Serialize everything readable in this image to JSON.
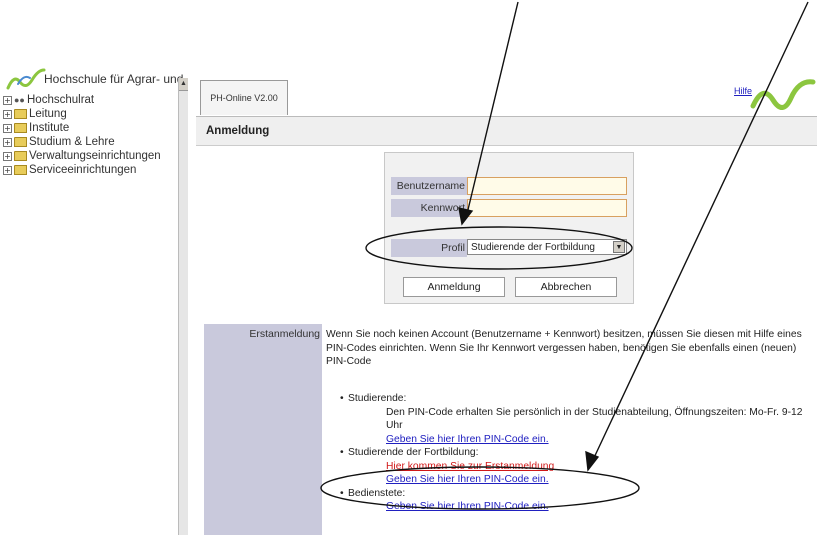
{
  "left_nav": {
    "university": "Hochschule für Agrar- und",
    "items": [
      {
        "label": "Hochschulrat",
        "icon": "people-icon"
      },
      {
        "label": "Leitung",
        "icon": "folder-icon"
      },
      {
        "label": "Institute",
        "icon": "folder-icon"
      },
      {
        "label": "Studium & Lehre",
        "icon": "folder-icon"
      },
      {
        "label": "Verwaltungseinrichtungen",
        "icon": "folder-icon"
      },
      {
        "label": "Serviceeinrichtungen",
        "icon": "folder-icon"
      }
    ]
  },
  "header": {
    "tab": "PH-Online V2.00",
    "help": "Hilfe",
    "page_title": "Anmeldung"
  },
  "login": {
    "username_label": "Benutzername",
    "username_value": "",
    "password_label": "Kennwort",
    "password_value": "",
    "profile_label": "Profil",
    "profile_value": "Studierende der Fortbildung",
    "login_button": "Anmeldung",
    "cancel_button": "Abbrechen"
  },
  "info": {
    "label": "Erstanmeldung",
    "text": "Wenn Sie noch keinen Account (Benutzername + Kennwort) besitzen, müssen Sie diesen mit Hilfe eines PIN-Codes einrichten. Wenn Sie Ihr Kennwort vergessen haben, benötigen Sie ebenfalls einen (neuen) PIN-Code",
    "groups": [
      {
        "title": "Studierende:",
        "desc": "Den PIN-Code erhalten Sie persönlich in der Studienabteilung, Öffnungszeiten: Mo-Fr. 9-12 Uhr",
        "links": [
          "Geben Sie hier Ihren PIN-Code ein."
        ]
      },
      {
        "title": "Studierende der Fortbildung:",
        "desc": "",
        "red_link": "Hier kommen Sie zur Erstanmeldung",
        "links": [
          "Geben Sie hier Ihren PIN-Code ein."
        ]
      },
      {
        "title": "Bedienstete:",
        "desc": "",
        "links": [
          "Geben Sie hier Ihren PIN-Code ein."
        ]
      }
    ]
  },
  "colors": {
    "label_bg": "#c9c9dc",
    "link": "#2020c0",
    "highlight_link": "#d01818",
    "logo_green": "#8cc63f"
  }
}
